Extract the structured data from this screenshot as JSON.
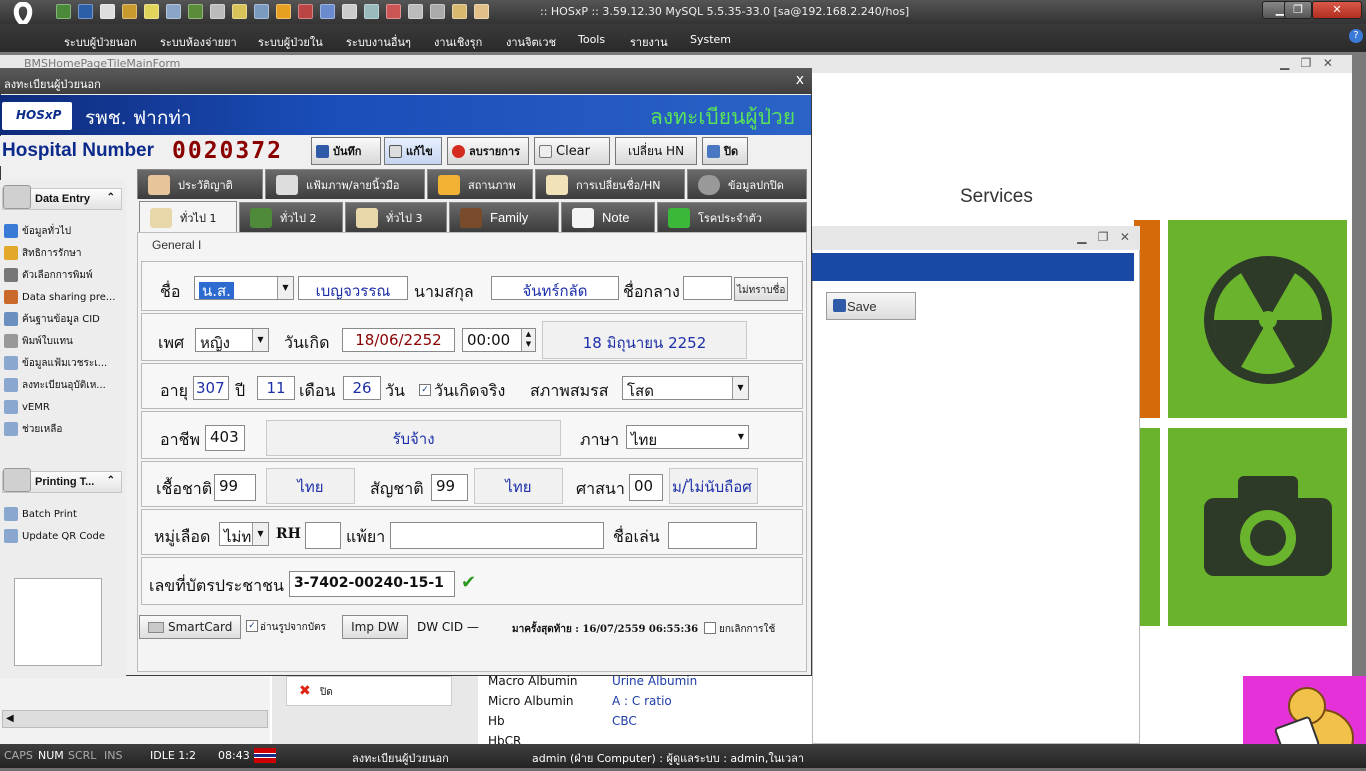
{
  "app": {
    "title": ":: HOSxP :: 3.59.12.30 MySQL 5.5.35-33.0 [sa@192.168.2.240/hos]"
  },
  "menu": [
    "ระบบผู้ป่วยนอก",
    "ระบบห้องจ่ายยา",
    "ระบบผู้ป่วยใน",
    "ระบบงานอื่นๆ",
    "งานเชิงรุก",
    "งานจิตเวช",
    "Tools",
    "รายงาน",
    "System"
  ],
  "background": {
    "form_title": "BMSHomePageTileMainForm",
    "services": "Services",
    "save_label": "Save",
    "close_label": "ปิด",
    "lab_rows": [
      {
        "name": "Macro Albumin",
        "value": "Urine Albumin"
      },
      {
        "name": "Micro Albumin",
        "value": "A : C ratio"
      },
      {
        "name": "Hb",
        "value": "CBC"
      },
      {
        "name": "HbCR",
        "value": ""
      }
    ]
  },
  "dialog": {
    "title": "ลงทะเบียนผู้ป่วยนอก",
    "close": "x",
    "logo": "HOSxP",
    "hospital": "รพช. ฟากท่า",
    "heading": "ลงทะเบียนผู้ป่วย",
    "hn_label": "Hospital Number",
    "hn_value": "0020372",
    "toolbar": {
      "save": "บันทึก",
      "edit": "แก้ไข",
      "delete": "ลบรายการ",
      "clear": "Clear",
      "change_hn": "เปลี่ยน HN",
      "close": "ปิด"
    },
    "left_groups": {
      "data_entry": "Data Entry",
      "data_items": [
        "ข้อมูลทั่วไป",
        "สิทธิการรักษา",
        "ตัวเลือกการพิมพ์",
        "Data sharing pre...",
        "ค้นฐานข้อมูล CID",
        "พิมพ์ใบแทน",
        "ข้อมูลแฟ้มเวชระเ...",
        "ลงทะเบียนอุบัติเห...",
        "vEMR",
        "ช่วยเหลือ"
      ],
      "printing": "Printing T...",
      "print_items": [
        "Batch Print",
        "Update QR Code"
      ]
    },
    "tabs_top": [
      "ประวัติญาติ",
      "แฟ้มภาพ/ลายนิ้วมือ",
      "สถานภาพ",
      "การเปลี่ยนชื่อ/HN",
      "ข้อมูลปกปิด"
    ],
    "tabs_bottom": [
      "ทั่วไป 1",
      "ทั่วไป 2",
      "ทั่วไป 3",
      "Family",
      "Note",
      "โรคประจำตัว"
    ],
    "general_label": "General I",
    "form": {
      "name_label": "ชื่อ",
      "prefix": "น.ส.",
      "first_name": "เบญจวรรณ",
      "surname_label": "นามสกุล",
      "surname": "จันทร์กลัด",
      "middle_label": "ชื่อกลาง",
      "middle": "",
      "unknown_name_btn": "ไม่ทราบชื่อ",
      "sex_label": "เพศ",
      "sex": "หญิง",
      "birth_label": "วันเกิด",
      "birth_date": "18/06/2252",
      "birth_time": "00:00",
      "birth_text": "18 มิถุนายน 2252",
      "age_label": "อายุ",
      "age_years": "307",
      "years_unit": "ปี",
      "age_months": "11",
      "months_unit": "เดือน",
      "age_days": "26",
      "days_unit": "วัน",
      "real_birth_label": "วันเกิดจริง",
      "marital_label": "สภาพสมรส",
      "marital": "โสด",
      "occupation_label": "อาชีพ",
      "occupation_code": "403",
      "occupation_text": "รับจ้าง",
      "language_label": "ภาษา",
      "language": "ไทย",
      "race_label": "เชื้อชาติ",
      "race_code": "99",
      "race_text": "ไทย",
      "nationality_label": "สัญชาติ",
      "nationality_code": "99",
      "nationality_text": "ไทย",
      "religion_label": "ศาสนา",
      "religion_code": "00",
      "religion_text": "ม/ไม่นับถือศ",
      "blood_label": "หมู่เลือด",
      "blood": "ไม่ท",
      "rh_label": "RH",
      "rh": "",
      "allergy_label": "แพ้ยา",
      "allergy": "",
      "nickname_label": "ชื่อเล่น",
      "nickname": "",
      "cid_label": "เลขที่บัตรประชาชน",
      "cid": "3-7402-00240-15-1"
    },
    "bottom": {
      "smartcard": "SmartCard",
      "read_photo": "อ่านรูปจากบัตร",
      "imp_dw": "Imp DW",
      "dw_cid": "DW CID —",
      "last_visit": "มาครั้งสุดท้าย : 16/07/2559 06:55:36",
      "cancel_use": "ยกเลิกการใช้"
    }
  },
  "statusbar": {
    "caps": "CAPS",
    "num": "NUM",
    "scrl": "SCRL",
    "ins": "INS",
    "idle": "IDLE 1:2",
    "time": "08:43",
    "form": "ลงทะเบียนผู้ป่วยนอก",
    "user": "admin (ฝ่าย Computer) : ผู้ดูแลระบบ : admin,ในเวลา"
  },
  "colors": {
    "brand_blue": "#1a4db8",
    "hn_red": "#8a0000",
    "heading_green": "#59e35a",
    "tile_green": "#6ab42d",
    "tile_orange": "#d46a0a"
  }
}
